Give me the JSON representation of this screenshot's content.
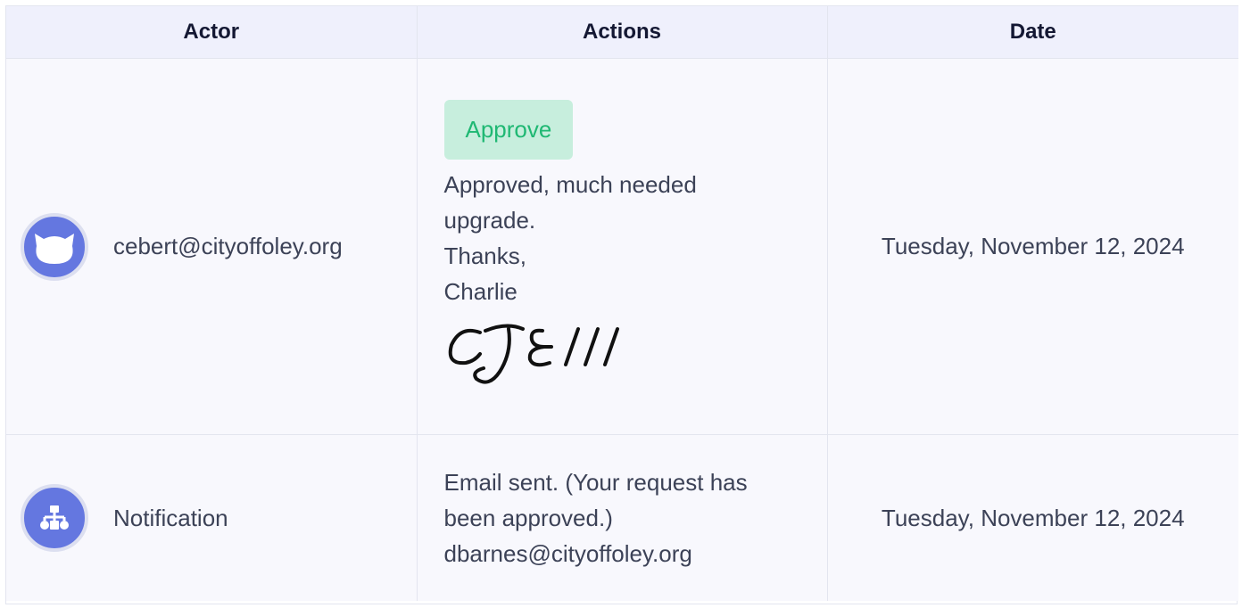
{
  "table": {
    "headers": {
      "actor": "Actor",
      "actions": "Actions",
      "date": "Date"
    },
    "rows": [
      {
        "actor": "cebert@cityoffoley.org",
        "actor_icon": "cat-avatar-icon",
        "badge": "Approve",
        "comment_lines": [
          "Approved, much needed",
          "upgrade.",
          "Thanks,",
          "Charlie"
        ],
        "signature_text": "CJEIII",
        "date": "Tuesday, November 12, 2024"
      },
      {
        "actor": "Notification",
        "actor_icon": "sitemap-icon",
        "comment_lines": [
          "Email sent. (Your request has",
          "been approved.)",
          "dbarnes@cityoffoley.org"
        ],
        "date": "Tuesday, November 12, 2024"
      }
    ]
  },
  "colors": {
    "avatar_bg": "#6477e0",
    "header_bg": "#eff0fc",
    "row_bg": "#f8f8fd",
    "approve_bg": "#c7eedd",
    "approve_text": "#1fb873"
  }
}
